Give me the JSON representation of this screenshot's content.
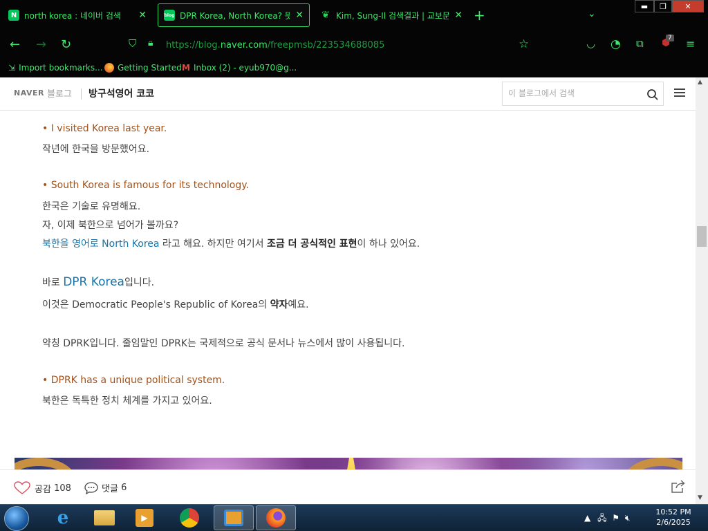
{
  "browser": {
    "tabs": [
      {
        "title": "north korea : 네이버 검색",
        "favicon": "N",
        "color": "#03c75a",
        "active": false
      },
      {
        "title": "DPR Korea, North Korea? 뜻, :",
        "favicon": "blog",
        "color": "#03c75a",
        "active": true
      },
      {
        "title": "Kim, Sung-Il 검색결과 | 교보문",
        "favicon": "kyobo",
        "color": "#2bd35b",
        "active": false
      }
    ],
    "new_tab": "+",
    "url_prefix": "https://blog.",
    "url_domain": "naver.com",
    "url_path": "/freepmsb/223534688085",
    "extension_badge": "7",
    "bookmarks": [
      {
        "label": "Import bookmarks..."
      },
      {
        "label": "Getting Started"
      },
      {
        "label": "Inbox (2) - eyub970@g..."
      }
    ]
  },
  "blog_header": {
    "naver": "NAVER",
    "blog_word": "블로그",
    "title": "방구석영어 코코",
    "search_placeholder": "이 블로그에서 검색"
  },
  "content": {
    "b1_en": "I visited Korea last year.",
    "b1_ko": "작년에 한국을 방문했어요.",
    "b2_en": "South Korea is famous for its technology.",
    "b2_ko1": "한국은 기술로 유명해요.",
    "b2_ko2": "자, 이제 북한으로 넘어가 볼까요?",
    "p1_blue": "북한을 영어로 North Korea",
    "p1_mid": " 라고 해요. 하지만 여기서 ",
    "p1_bold": "조금 더 공식적인 표현",
    "p1_end": "이 하나 있어요.",
    "p2_pre": "바로 ",
    "p2_big": "DPR Korea",
    "p2_post": "입니다.",
    "p3_pre": "이것은 Democratic People's Republic of Korea의 ",
    "p3_bold": "약자",
    "p3_post": "예요.",
    "p4": "약칭 DPRK입니다. 줄임말인 DPRK는 국제적으로 공식 문서나 뉴스에서 많이 사용됩니다.",
    "b3_en": "DPRK has a unique political system.",
    "b3_ko": "북한은 독특한 정치 체계를 가지고 있어요."
  },
  "footer": {
    "like_label": "공감",
    "like_count": "108",
    "comment_label": "댓글",
    "comment_count": "6"
  },
  "taskbar": {
    "time": "10:52 PM",
    "date": "2/6/2025"
  }
}
